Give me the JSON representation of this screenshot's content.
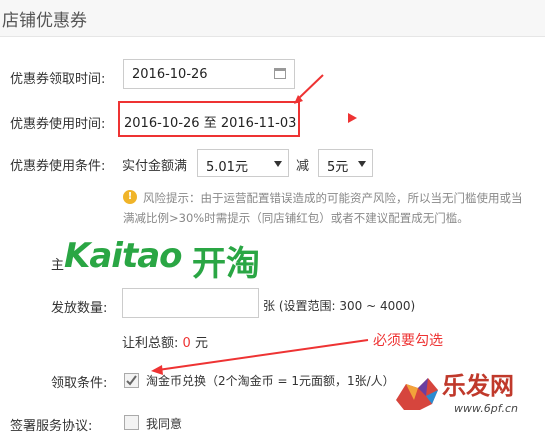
{
  "header": {
    "title": "店铺优惠券"
  },
  "receive_time": {
    "label": "优惠券领取时间:",
    "value": "2016-10-26"
  },
  "use_time": {
    "label": "优惠券使用时间:",
    "start": "2016-10-26",
    "separator": "至",
    "end": "2016-11-03"
  },
  "condition": {
    "label": "优惠券使用条件:",
    "prefix": "实付金额满",
    "threshold": "5.01元",
    "minus_label": "减",
    "discount": "5元"
  },
  "risk": {
    "line1": "风险提示：由于运营配置错误造成的可能资产风险，所以当无门槛使用或当",
    "line2": "满减比例>30%时需提示（同店铺红包）或者不建议配置成无门槛。"
  },
  "logo": {
    "text_latin": "Kaitao",
    "text_cn": "开淘",
    "hidden_label": "主"
  },
  "issue_qty": {
    "label": "发放数量:",
    "value": "",
    "suffix": "张 (设置范围: 300 ~ 4000)"
  },
  "total_profit": {
    "label": "让利总额:",
    "value": "0",
    "unit": "元"
  },
  "annotation": {
    "text": "必须要勾选"
  },
  "receive_condition": {
    "label": "领取条件:",
    "option": "淘金币兑换（2个淘金币 = 1元面额，1张/人）",
    "checked": true
  },
  "agreement": {
    "label": "签署服务协议:",
    "option": "我同意"
  },
  "watermark": {
    "brand": "乐发网",
    "url": "www.6pf.cn"
  },
  "colors": {
    "accent_red": "#e33333",
    "logo_green": "#2aa644",
    "warning": "#f0b429"
  }
}
